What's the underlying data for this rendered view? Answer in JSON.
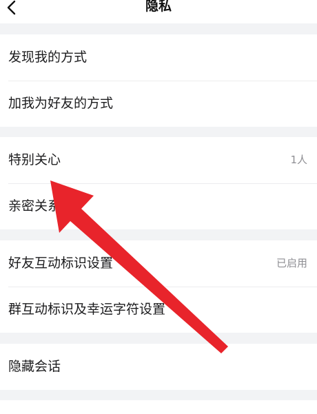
{
  "nav": {
    "title": "隐私",
    "back_icon": "chevron-left-icon"
  },
  "groups": [
    {
      "rows": [
        {
          "label": "发现我的方式",
          "value": ""
        },
        {
          "label": "加我为好友的方式",
          "value": ""
        }
      ]
    },
    {
      "rows": [
        {
          "label": "特别关心",
          "value": "1人"
        },
        {
          "label": "亲密关系",
          "value": ""
        }
      ]
    },
    {
      "rows": [
        {
          "label": "好友互动标识设置",
          "value": "已启用"
        },
        {
          "label": "群互动标识及幸运字符设置",
          "value": ""
        }
      ]
    },
    {
      "rows": [
        {
          "label": "隐藏会话",
          "value": ""
        }
      ]
    }
  ],
  "colors": {
    "background": "#f2f3f5",
    "arrow": "#e8242b"
  }
}
